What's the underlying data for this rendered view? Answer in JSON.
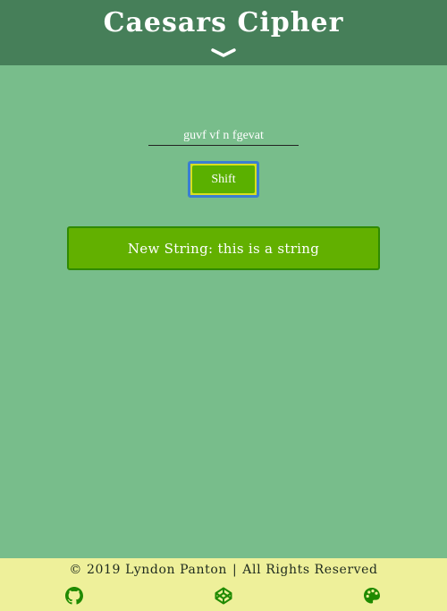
{
  "header": {
    "title": "Caesars Cipher",
    "chevron_icon": "chevron-down-icon"
  },
  "form": {
    "input_value": "guvf vf n fgevat",
    "shift_label": "Shift"
  },
  "result": {
    "text": "New String: this is a string"
  },
  "footer": {
    "copyright": "© 2019 Lyndon Panton",
    "separator": "|",
    "rights": "All Rights Reserved",
    "links": [
      {
        "icon": "github-icon"
      },
      {
        "icon": "codepen-icon"
      },
      {
        "icon": "palette-icon"
      }
    ]
  },
  "colors": {
    "header_bg": "#467f59",
    "page_bg": "#78bd8b",
    "button_green": "#5ab000",
    "footer_bg": "#eef09a",
    "icon_green": "#1f8a00"
  }
}
